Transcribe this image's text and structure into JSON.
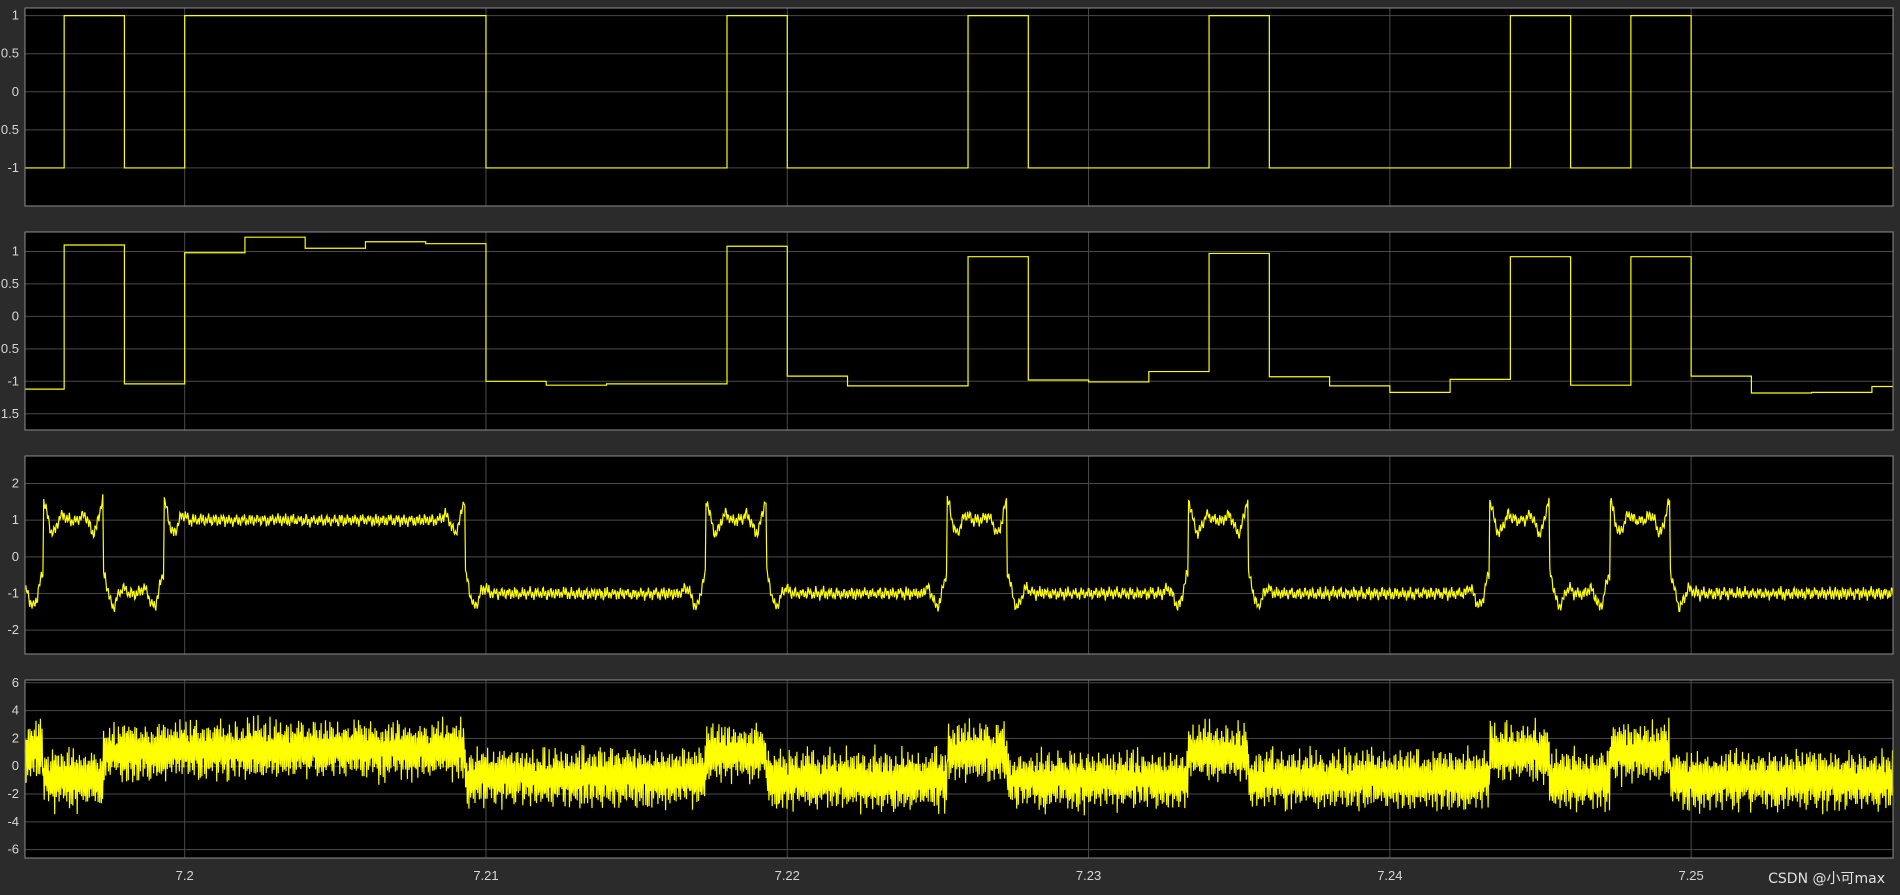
{
  "colors": {
    "figure_bg": "#2b2b2b",
    "axes_bg": "#000000",
    "axes_border": "#8c8c8c",
    "grid": "#4a4a4a",
    "trace": "#ffff00",
    "tick_text": "#d6d6d6"
  },
  "watermark": "CSDN @小可max",
  "chart_data": [
    {
      "type": "line",
      "title": "",
      "xlabel": "",
      "ylabel": "",
      "xlim": [
        7.1947,
        7.2567
      ],
      "ylim": [
        -1.5,
        1.1
      ],
      "yticks": [
        -1,
        -0.5,
        0,
        0.5,
        1
      ],
      "ytick_labels": [
        "-1",
        "0.5",
        "0",
        "0.5",
        "1"
      ],
      "xticks": [
        7.2,
        7.21,
        7.22,
        7.23,
        7.24,
        7.25
      ],
      "grid": true,
      "series": [
        {
          "style": "step",
          "x": [
            7.1947,
            7.196,
            7.198,
            7.2,
            7.21,
            7.218,
            7.22,
            7.226,
            7.228,
            7.234,
            7.236,
            7.244,
            7.246,
            7.248,
            7.25,
            7.2567
          ],
          "values": [
            -1,
            1,
            -1,
            1,
            -1,
            1,
            -1,
            1,
            -1,
            1,
            -1,
            1,
            -1,
            1,
            -1,
            -1
          ]
        }
      ]
    },
    {
      "type": "line",
      "title": "",
      "xlabel": "",
      "ylabel": "",
      "xlim": [
        7.1947,
        7.2567
      ],
      "ylim": [
        -1.75,
        1.3
      ],
      "yticks": [
        -1.5,
        -1,
        -0.5,
        0,
        0.5,
        1
      ],
      "ytick_labels": [
        "1.5",
        "-1",
        "0.5",
        "0",
        "0.5",
        "1"
      ],
      "xticks": [
        7.2,
        7.21,
        7.22,
        7.23,
        7.24,
        7.25
      ],
      "grid": true,
      "series": [
        {
          "style": "step",
          "x": [
            7.1947,
            7.196,
            7.198,
            7.2,
            7.202,
            7.204,
            7.206,
            7.208,
            7.21,
            7.212,
            7.214,
            7.218,
            7.22,
            7.222,
            7.226,
            7.228,
            7.23,
            7.232,
            7.234,
            7.236,
            7.238,
            7.24,
            7.242,
            7.244,
            7.246,
            7.248,
            7.25,
            7.252,
            7.254,
            7.256,
            7.2567
          ],
          "values": [
            -1.12,
            1.1,
            -1.04,
            0.98,
            1.22,
            1.05,
            1.15,
            1.12,
            -1.0,
            -1.06,
            -1.04,
            1.08,
            -0.92,
            -1.07,
            0.92,
            -0.98,
            -1.01,
            -0.85,
            0.97,
            -0.93,
            -1.07,
            -1.17,
            -0.97,
            0.92,
            -1.06,
            0.92,
            -0.92,
            -1.18,
            -1.17,
            -1.08,
            -1.08
          ]
        }
      ]
    },
    {
      "type": "line",
      "title": "",
      "xlabel": "",
      "ylabel": "",
      "xlim": [
        7.1947,
        7.2567
      ],
      "ylim": [
        -2.65,
        2.75
      ],
      "yticks": [
        -2,
        -1,
        0,
        1,
        2
      ],
      "ytick_labels": [
        "-2",
        "-1",
        "0",
        "1",
        "2"
      ],
      "xticks": [
        7.2,
        7.21,
        7.22,
        7.23,
        7.24,
        7.25
      ],
      "grid": true,
      "series": [
        {
          "style": "ringing",
          "levels_x": [
            7.1947,
            7.1953,
            7.1973,
            7.1993,
            7.2093,
            7.2173,
            7.2193,
            7.2253,
            7.2273,
            7.2333,
            7.2353,
            7.2433,
            7.2453,
            7.2473,
            7.2493,
            7.2567
          ],
          "levels": [
            -1,
            1,
            -1,
            1,
            -1,
            1,
            -1,
            1,
            -1,
            1,
            -1,
            1,
            -1,
            1,
            -1,
            -1
          ],
          "overshoot_peak": 1.8,
          "undershoot_min": -2.1
        }
      ]
    },
    {
      "type": "line",
      "title": "",
      "xlabel": "",
      "ylabel": "",
      "xlim": [
        7.1947,
        7.2567
      ],
      "ylim": [
        -6.6,
        6.2
      ],
      "yticks": [
        -6,
        -4,
        -2,
        0,
        2,
        4,
        6
      ],
      "ytick_labels": [
        "-6",
        "-4",
        "-2",
        "0",
        "2",
        "4",
        "6"
      ],
      "xticks": [
        7.2,
        7.21,
        7.22,
        7.23,
        7.24,
        7.25
      ],
      "xtick_labels": [
        "7.2",
        "7.21",
        "7.22",
        "7.23",
        "7.24",
        "7.25"
      ],
      "grid": true,
      "series": [
        {
          "style": "noisy",
          "levels_x": [
            7.1947,
            7.1953,
            7.1973,
            7.1993,
            7.2093,
            7.2173,
            7.2193,
            7.2253,
            7.2273,
            7.2333,
            7.2353,
            7.2433,
            7.2453,
            7.2473,
            7.2493,
            7.2567
          ],
          "levels": [
            1,
            -1,
            1,
            1.2,
            -0.8,
            1,
            -1,
            1,
            -1,
            1,
            -1,
            1,
            -1,
            1,
            -1,
            -1
          ],
          "max": 4.1,
          "min": -4.3
        }
      ]
    }
  ]
}
